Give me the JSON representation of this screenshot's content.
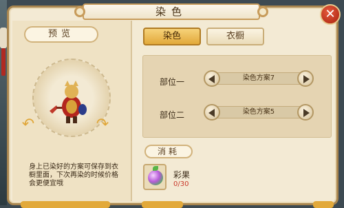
{
  "dialog": {
    "title": "染色",
    "close": "✕"
  },
  "preview": {
    "title": "预览",
    "note": "身上已染好的方案可保存到衣橱里面，下次再染的时候价格会更便宜哦"
  },
  "tabs": [
    {
      "label": "染色",
      "active": true
    },
    {
      "label": "衣橱",
      "active": false
    }
  ],
  "parts": [
    {
      "label": "部位一",
      "value": "染色方案7"
    },
    {
      "label": "部位二",
      "value": "染色方案5"
    }
  ],
  "cost": {
    "title": "消耗",
    "item": {
      "name": "彩果",
      "count": "0/30"
    }
  },
  "colors": {
    "accent": "#e2a93a",
    "panel_bg": "#f3ead4",
    "count_red": "#c9382a"
  }
}
